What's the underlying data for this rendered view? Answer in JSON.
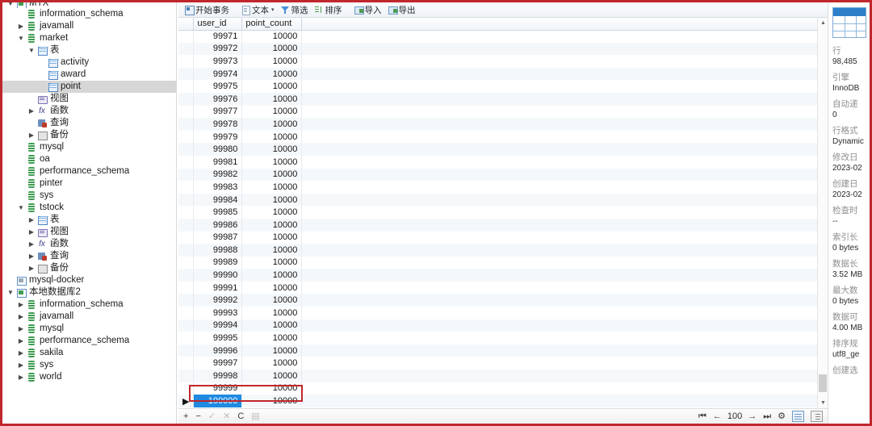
{
  "sidebar": {
    "items": [
      {
        "label": "MTX",
        "icon": "connection-icon",
        "indent": 0,
        "twisty": "v",
        "partial": true,
        "selected": false
      },
      {
        "label": "information_schema",
        "icon": "database-icon",
        "indent": 1,
        "twisty": "",
        "selected": false
      },
      {
        "label": "javamall",
        "icon": "database-icon",
        "indent": 1,
        "twisty": ">",
        "selected": false
      },
      {
        "label": "market",
        "icon": "database-icon",
        "indent": 1,
        "twisty": "v",
        "selected": false
      },
      {
        "label": "表",
        "icon": "table-folder-icon",
        "indent": 2,
        "twisty": "v",
        "selected": false
      },
      {
        "label": "activity",
        "icon": "table-icon",
        "indent": 3,
        "twisty": "",
        "selected": false
      },
      {
        "label": "award",
        "icon": "table-icon",
        "indent": 3,
        "twisty": "",
        "selected": false
      },
      {
        "label": "point",
        "icon": "table-icon",
        "indent": 3,
        "twisty": "",
        "selected": true
      },
      {
        "label": "视图",
        "icon": "view-icon",
        "indent": 2,
        "twisty": "",
        "selected": false
      },
      {
        "label": "函数",
        "icon": "function-icon",
        "indent": 2,
        "twisty": ">",
        "selected": false
      },
      {
        "label": "查询",
        "icon": "query-icon",
        "indent": 2,
        "twisty": "",
        "selected": false
      },
      {
        "label": "备份",
        "icon": "backup-icon",
        "indent": 2,
        "twisty": ">",
        "selected": false
      },
      {
        "label": "mysql",
        "icon": "database-icon",
        "indent": 1,
        "twisty": "",
        "selected": false
      },
      {
        "label": "oa",
        "icon": "database-icon",
        "indent": 1,
        "twisty": "",
        "selected": false
      },
      {
        "label": "performance_schema",
        "icon": "database-icon",
        "indent": 1,
        "twisty": "",
        "selected": false
      },
      {
        "label": "pinter",
        "icon": "database-icon",
        "indent": 1,
        "twisty": "",
        "selected": false
      },
      {
        "label": "sys",
        "icon": "database-icon",
        "indent": 1,
        "twisty": "",
        "selected": false
      },
      {
        "label": "tstock",
        "icon": "database-icon",
        "indent": 1,
        "twisty": "v",
        "selected": false
      },
      {
        "label": "表",
        "icon": "table-folder-icon",
        "indent": 2,
        "twisty": ">",
        "selected": false
      },
      {
        "label": "视图",
        "icon": "view-icon",
        "indent": 2,
        "twisty": ">",
        "selected": false
      },
      {
        "label": "函数",
        "icon": "function-icon",
        "indent": 2,
        "twisty": ">",
        "selected": false
      },
      {
        "label": "查询",
        "icon": "query-icon",
        "indent": 2,
        "twisty": ">",
        "selected": false
      },
      {
        "label": "备份",
        "icon": "backup-icon",
        "indent": 2,
        "twisty": ">",
        "selected": false
      },
      {
        "label": "mysql-docker",
        "icon": "connection-gray-icon",
        "indent": 0,
        "twisty": "",
        "selected": false
      },
      {
        "label": "本地数据库2",
        "icon": "connection-icon",
        "indent": 0,
        "twisty": "v",
        "selected": false
      },
      {
        "label": "information_schema",
        "icon": "database-icon",
        "indent": 1,
        "twisty": ">",
        "selected": false
      },
      {
        "label": "javamall",
        "icon": "database-icon",
        "indent": 1,
        "twisty": ">",
        "selected": false
      },
      {
        "label": "mysql",
        "icon": "database-icon",
        "indent": 1,
        "twisty": ">",
        "selected": false
      },
      {
        "label": "performance_schema",
        "icon": "database-icon",
        "indent": 1,
        "twisty": ">",
        "selected": false
      },
      {
        "label": "sakila",
        "icon": "database-icon",
        "indent": 1,
        "twisty": ">",
        "selected": false
      },
      {
        "label": "sys",
        "icon": "database-icon",
        "indent": 1,
        "twisty": ">",
        "selected": false
      },
      {
        "label": "world",
        "icon": "database-icon",
        "indent": 1,
        "twisty": ">",
        "selected": false
      }
    ]
  },
  "toolbar": {
    "begin_transaction": "开始事务",
    "text": "文本",
    "text_caret": "▾",
    "filter": "筛选",
    "sort": "排序",
    "import": "导入",
    "export": "导出"
  },
  "grid": {
    "columns": [
      "user_id",
      "point_count"
    ],
    "rows": [
      [
        "99971",
        "10000"
      ],
      [
        "99972",
        "10000"
      ],
      [
        "99973",
        "10000"
      ],
      [
        "99974",
        "10000"
      ],
      [
        "99975",
        "10000"
      ],
      [
        "99976",
        "10000"
      ],
      [
        "99977",
        "10000"
      ],
      [
        "99978",
        "10000"
      ],
      [
        "99979",
        "10000"
      ],
      [
        "99980",
        "10000"
      ],
      [
        "99981",
        "10000"
      ],
      [
        "99982",
        "10000"
      ],
      [
        "99983",
        "10000"
      ],
      [
        "99984",
        "10000"
      ],
      [
        "99985",
        "10000"
      ],
      [
        "99986",
        "10000"
      ],
      [
        "99987",
        "10000"
      ],
      [
        "99988",
        "10000"
      ],
      [
        "99989",
        "10000"
      ],
      [
        "99990",
        "10000"
      ],
      [
        "99991",
        "10000"
      ],
      [
        "99992",
        "10000"
      ],
      [
        "99993",
        "10000"
      ],
      [
        "99994",
        "10000"
      ],
      [
        "99995",
        "10000"
      ],
      [
        "99996",
        "10000"
      ],
      [
        "99997",
        "10000"
      ],
      [
        "99998",
        "10000"
      ],
      [
        "99999",
        "10000"
      ],
      [
        "100000",
        "10000"
      ]
    ],
    "selected_row_index": 29,
    "current_row_marker": "▶"
  },
  "statusbar": {
    "add": "+",
    "remove": "−",
    "confirm": "✓",
    "cancel": "✕",
    "refresh": "C",
    "stop": "▤",
    "first": "⏮",
    "prev": "←",
    "page_value": "100",
    "next": "→",
    "last": "⏭",
    "settings": "⚙",
    "grid_view": "grid-view",
    "form_view": "form-view"
  },
  "infopanel": {
    "fields": [
      {
        "label": "行",
        "value": "98,485"
      },
      {
        "label": "引擎",
        "value": "InnoDB"
      },
      {
        "label": "自动递",
        "value": "0"
      },
      {
        "label": "行格式",
        "value": "Dynamic"
      },
      {
        "label": "修改日",
        "value": "2023-02"
      },
      {
        "label": "创建日",
        "value": "2023-02"
      },
      {
        "label": "检查时",
        "value": "--"
      },
      {
        "label": "索引长",
        "value": "0 bytes"
      },
      {
        "label": "数据长",
        "value": "3.52 MB"
      },
      {
        "label": "最大数",
        "value": "0 bytes"
      },
      {
        "label": "数据可",
        "value": "4.00 MB"
      },
      {
        "label": "排序规",
        "value": "utf8_ge"
      },
      {
        "label": "创建选",
        "value": ""
      }
    ]
  },
  "colors": {
    "annotation": "#c0272d",
    "selection": "#1f8ae0",
    "tree_selection": "#d6d6d6"
  }
}
